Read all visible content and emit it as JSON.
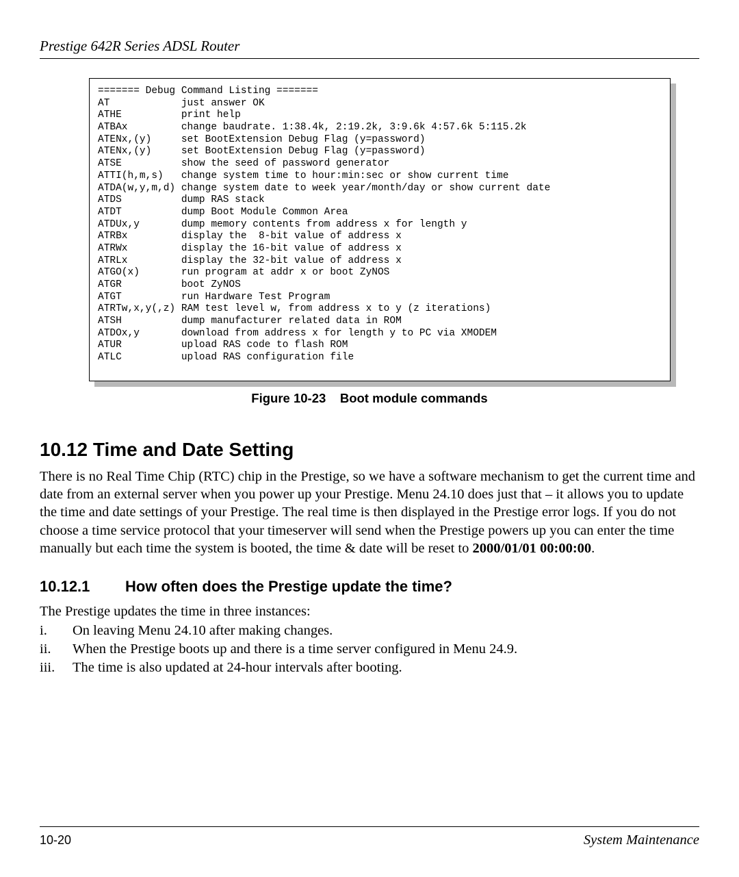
{
  "header": {
    "title": "Prestige 642R Series ADSL Router"
  },
  "code": {
    "heading": "======= Debug Command Listing =======",
    "rows": [
      {
        "cmd": "AT",
        "desc": "just answer OK"
      },
      {
        "cmd": "ATHE",
        "desc": "print help"
      },
      {
        "cmd": "ATBAx",
        "desc": "change baudrate. 1:38.4k, 2:19.2k, 3:9.6k 4:57.6k 5:115.2k"
      },
      {
        "cmd": "ATENx,(y)",
        "desc": "set BootExtension Debug Flag (y=password)"
      },
      {
        "cmd": "ATENx,(y)",
        "desc": "set BootExtension Debug Flag (y=password)"
      },
      {
        "cmd": "ATSE",
        "desc": "show the seed of password generator"
      },
      {
        "cmd": "ATTI(h,m,s)",
        "desc": "change system time to hour:min:sec or show current time"
      },
      {
        "cmd": "ATDA(w,y,m,d)",
        "desc": "change system date to week year/month/day or show current date"
      },
      {
        "cmd": "ATDS",
        "desc": "dump RAS stack"
      },
      {
        "cmd": "ATDT",
        "desc": "dump Boot Module Common Area"
      },
      {
        "cmd": "ATDUx,y",
        "desc": "dump memory contents from address x for length y"
      },
      {
        "cmd": "ATRBx",
        "desc": "display the  8-bit value of address x"
      },
      {
        "cmd": "ATRWx",
        "desc": "display the 16-bit value of address x"
      },
      {
        "cmd": "ATRLx",
        "desc": "display the 32-bit value of address x"
      },
      {
        "cmd": "ATGO(x)",
        "desc": "run program at addr x or boot ZyNOS"
      },
      {
        "cmd": "ATGR",
        "desc": "boot ZyNOS"
      },
      {
        "cmd": "ATGT",
        "desc": "run Hardware Test Program"
      },
      {
        "cmd": "ATRTw,x,y(,z)",
        "desc": "RAM test level w, from address x to y (z iterations)"
      },
      {
        "cmd": "ATSH",
        "desc": "dump manufacturer related data in ROM"
      },
      {
        "cmd": "ATDOx,y",
        "desc": "download from address x for length y to PC via XMODEM"
      },
      {
        "cmd": "ATUR",
        "desc": "upload RAS code to flash ROM"
      },
      {
        "cmd": "ATLC",
        "desc": "upload RAS configuration file"
      }
    ]
  },
  "figure": {
    "label": "Figure 10-23",
    "title": "Boot module commands"
  },
  "section": {
    "number": "10.12",
    "title": "Time and Date Setting",
    "para_before_bold": "There is no Real Time Chip (RTC) chip in the Prestige, so we have a software mechanism to get the current time and date from an external server when you power up your Prestige. Menu 24.10 does just that – it allows you to update the time and date settings of your Prestige. The real time is then displayed in the Prestige error logs. If you do not choose a time service protocol that your timeserver will send when the Prestige powers up you can enter the time manually but each time the system is booted, the time & date will be reset to ",
    "bold_value": "2000/01/01 00:00:00",
    "para_after_bold": "."
  },
  "subsection": {
    "number": "10.12.1",
    "title": "How often does the Prestige update the time?",
    "intro": "The Prestige updates the time in three instances:",
    "items": [
      {
        "marker": "i.",
        "text": "On leaving Menu 24.10 after making changes."
      },
      {
        "marker": "ii.",
        "text": "When the Prestige boots up and there is a time server configured in Menu 24.9."
      },
      {
        "marker": "iii.",
        "text": "The time is also updated at 24-hour intervals after booting."
      }
    ]
  },
  "footer": {
    "page": "10-20",
    "right": "System Maintenance"
  }
}
